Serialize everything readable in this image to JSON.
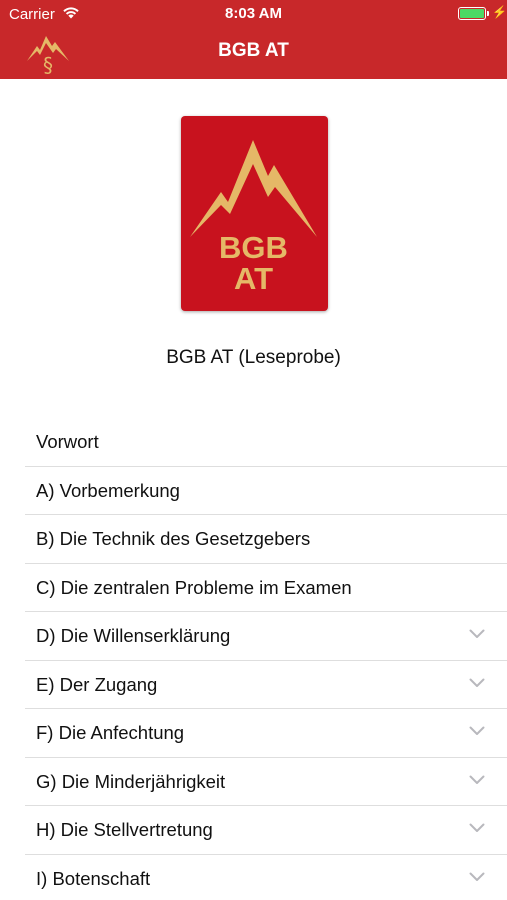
{
  "status_bar": {
    "carrier": "Carrier",
    "time": "8:03 AM",
    "battery_level": 1.0,
    "battery_color": "#4cd964"
  },
  "nav": {
    "title": "BGB AT",
    "logo_icon": "mountain-paragraph-logo",
    "background_color": "#c8282a"
  },
  "book": {
    "cover_lines": [
      "BGB",
      "AT"
    ],
    "cover_color": "#c8121e",
    "cover_accent": "#e5b867",
    "title": "BGB AT (Leseprobe)"
  },
  "toc": [
    {
      "label": "Vorwort",
      "expandable": false
    },
    {
      "label": "A) Vorbemerkung",
      "expandable": false
    },
    {
      "label": "B) Die Technik des Gesetzgebers",
      "expandable": false
    },
    {
      "label": "C) Die zentralen Probleme im Examen",
      "expandable": false
    },
    {
      "label": "D) Die Willenserklärung",
      "expandable": true
    },
    {
      "label": "E) Der Zugang",
      "expandable": true
    },
    {
      "label": "F) Die Anfechtung",
      "expandable": true
    },
    {
      "label": "G) Die Minderjährigkeit",
      "expandable": true
    },
    {
      "label": "H) Die Stellvertretung",
      "expandable": true
    },
    {
      "label": "I) Botenschaft",
      "expandable": true
    }
  ]
}
